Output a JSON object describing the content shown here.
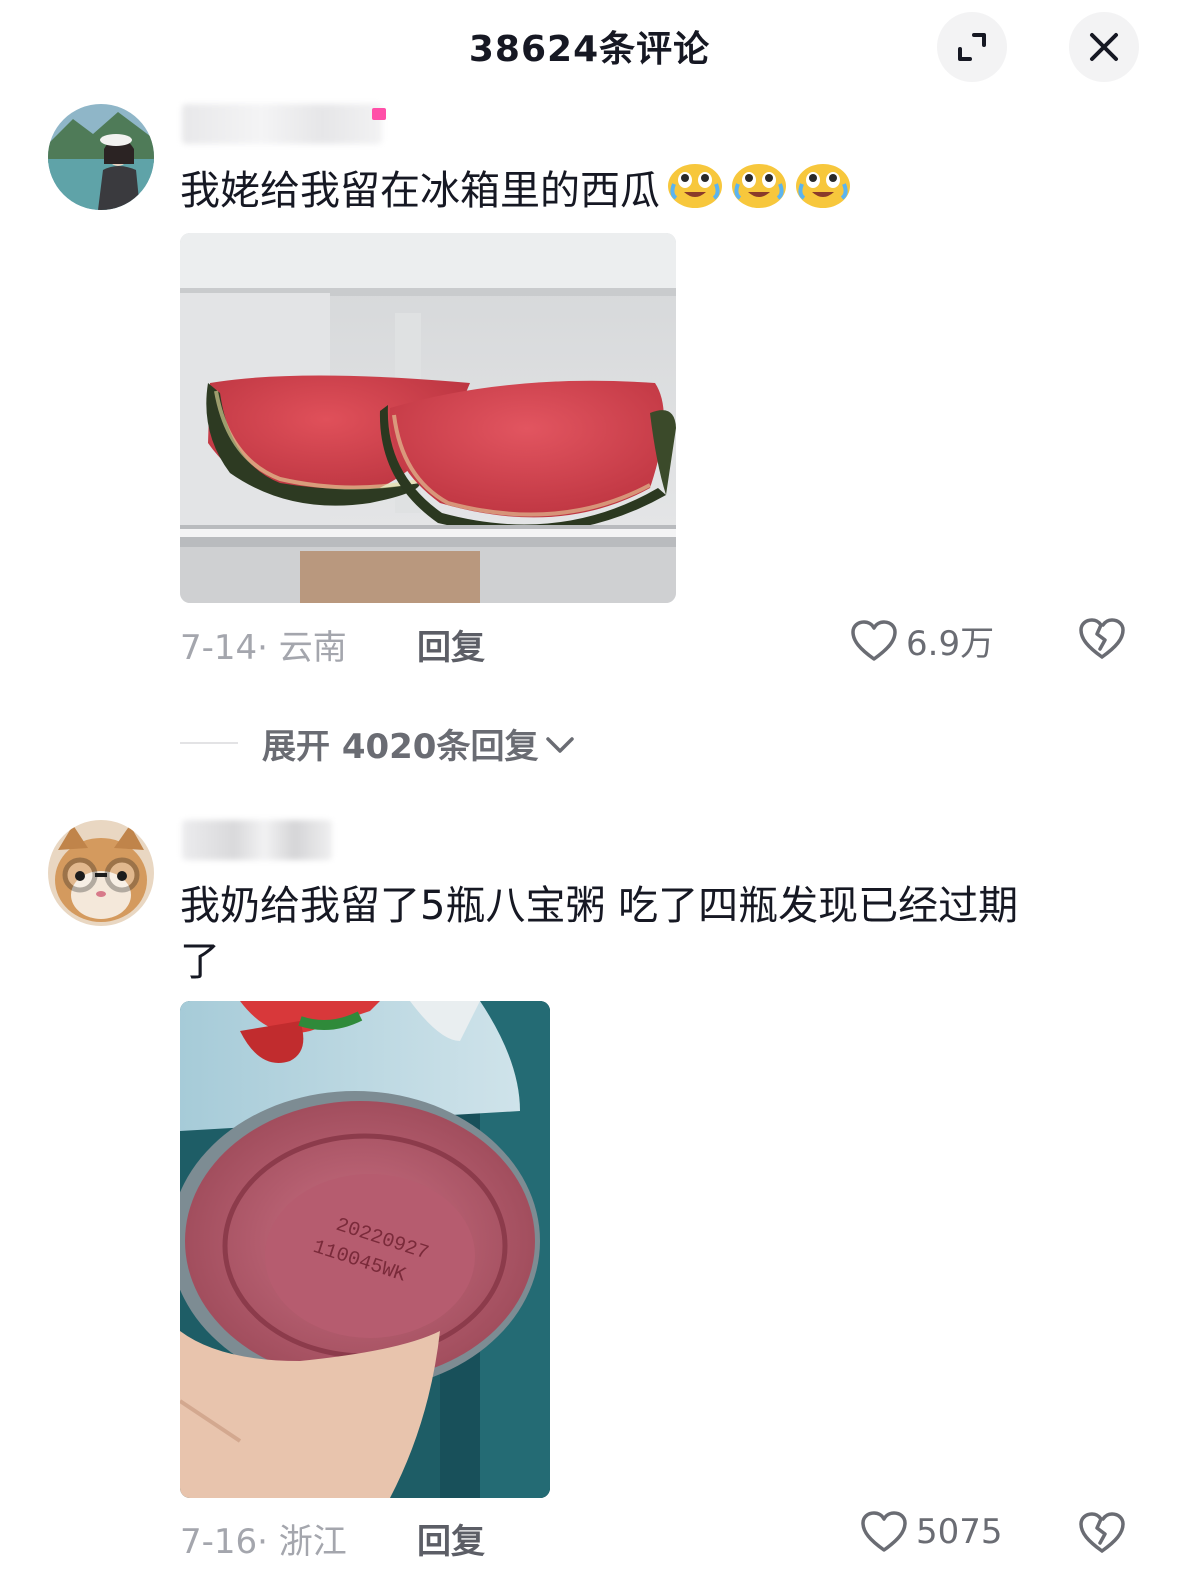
{
  "header": {
    "title": "38624条评论"
  },
  "comments": [
    {
      "text": "我姥给我留在冰箱里的西瓜",
      "emoji_count": 3,
      "date_location": "7-14· 云南",
      "reply_label": "回复",
      "like_count": "6.9万"
    },
    {
      "text_line1": "我奶给我留了5瓶八宝粥 吃了四瓶发现已经过期",
      "text_line2": "了",
      "can_print_line1": "20220927",
      "can_print_line2": "110045WK",
      "date_location": "7-16· 浙江",
      "reply_label": "回复",
      "like_count": "5075"
    }
  ],
  "expand_replies": {
    "label": "展开 4020条回复"
  },
  "icons": {
    "expand": "expand-icon",
    "close": "close-icon",
    "like": "heart-icon",
    "dislike": "broken-heart-icon",
    "chevron": "chevron-down-icon",
    "emoji": "crying-laughing-emoji-icon"
  }
}
